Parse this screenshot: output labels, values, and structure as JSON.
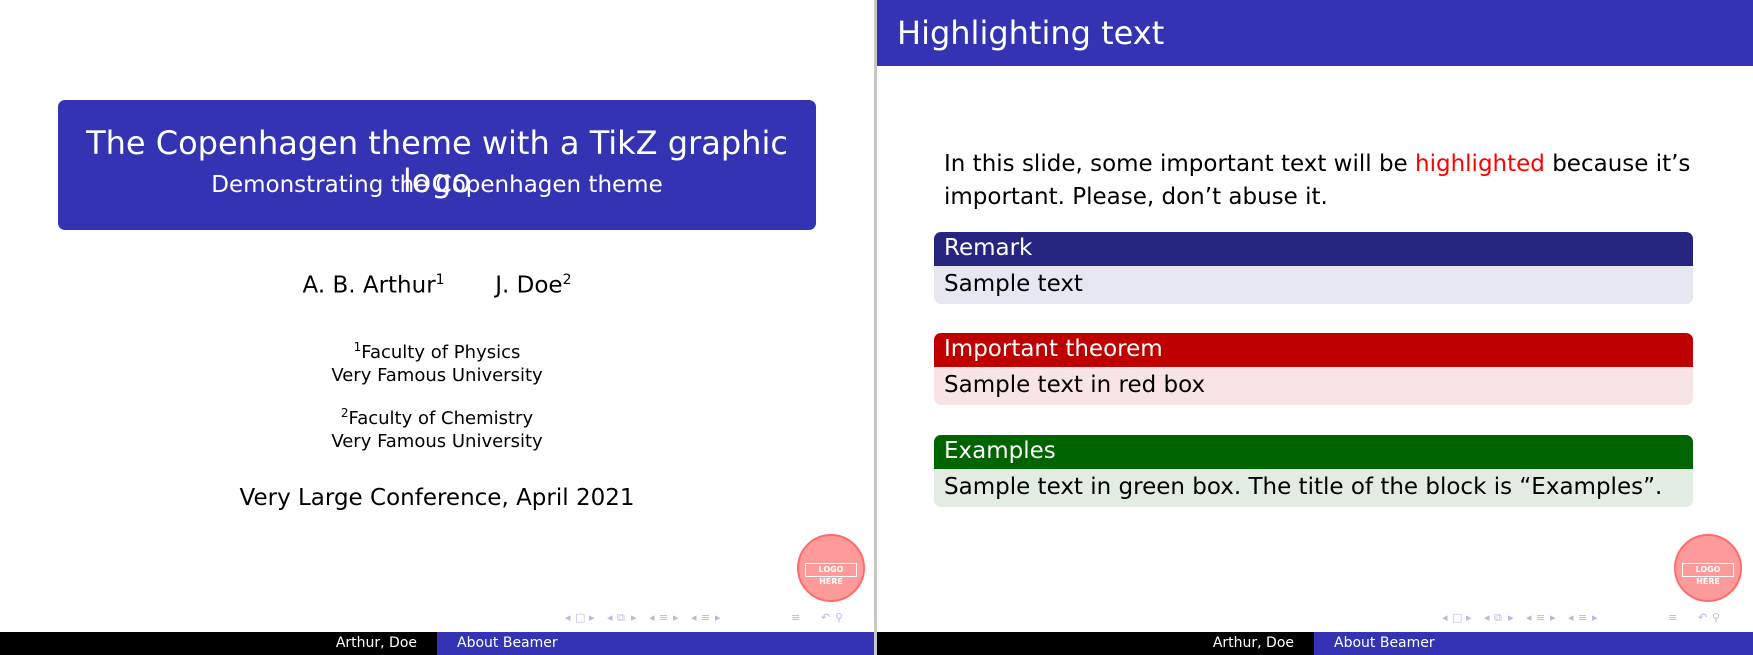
{
  "slide1": {
    "title": "The Copenhagen theme with a TikZ graphic logo",
    "subtitle": "Demonstrating the Copenhagen theme",
    "authors": [
      {
        "name": "A. B. Arthur",
        "mark": "1"
      },
      {
        "name": "J. Doe",
        "mark": "2"
      }
    ],
    "institutes": [
      {
        "mark": "1",
        "line1": "Faculty of Physics",
        "line2": "Very Famous University"
      },
      {
        "mark": "2",
        "line1": "Faculty of Chemistry",
        "line2": "Very Famous University"
      }
    ],
    "date": "Very Large Conference, April 2021",
    "logo_text": "LOGO HERE",
    "footer": {
      "authors": "Arthur, Doe",
      "title": "About Beamer"
    }
  },
  "slide2": {
    "frame_title": "Highlighting text",
    "paragraph": {
      "before": "In this slide, some important text will be ",
      "highlight": "highlighted",
      "after": " because it’s important. Please, don’t abuse it."
    },
    "blocks": [
      {
        "title": "Remark",
        "body": "Sample text"
      },
      {
        "title": "Important theorem",
        "body": "Sample text in red box"
      },
      {
        "title": "Examples",
        "body": "Sample text in green box. The title of the block is “Examples”."
      }
    ],
    "logo_text": "LOGO HERE",
    "footer": {
      "authors": "Arthur, Doe",
      "title": "About Beamer"
    }
  },
  "nav_icons": [
    "nav-prev-arrow",
    "nav-slide-icon",
    "nav-next-arrow",
    "nav-frame-icon",
    "nav-subsection-icon",
    "nav-section-icon",
    "nav-align-icon",
    "nav-search-icon"
  ],
  "colors": {
    "structure": "#3333b3",
    "remark_title": "#262680",
    "alert_title": "#bf0000",
    "example_title": "#006400",
    "highlight": "#ff0000"
  }
}
